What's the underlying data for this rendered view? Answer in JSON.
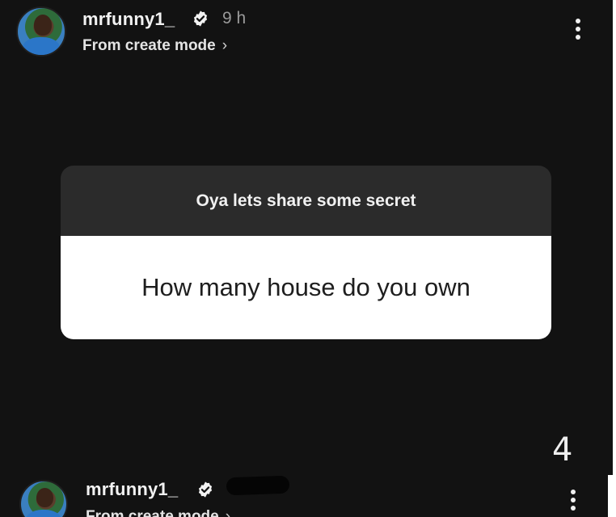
{
  "top_post": {
    "username": "mrfunny1_",
    "time": "9 h",
    "subtitle": "From create mode",
    "chevron": "›",
    "question_header": "Oya lets share some secret",
    "question_text": "How many house do you own",
    "page_number": "4",
    "icons": {
      "verified": "verified-badge-icon",
      "menu": "more-vertical-icon"
    }
  },
  "bottom_post": {
    "username": "mrfunny1_",
    "subtitle": "From create mode",
    "chevron": "›",
    "icons": {
      "verified": "verified-badge-icon",
      "menu": "more-vertical-icon"
    }
  },
  "colors": {
    "background": "#121212",
    "card_header": "#2b2b2b",
    "card_body": "#ffffff"
  }
}
